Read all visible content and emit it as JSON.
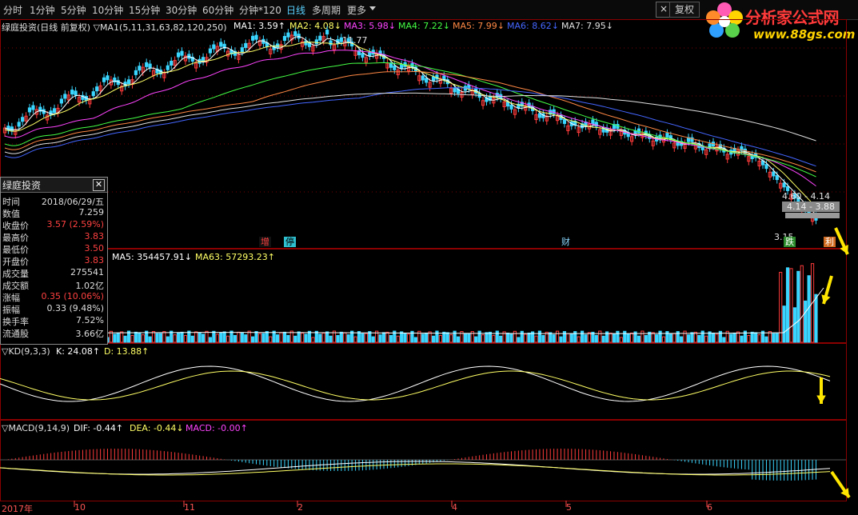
{
  "toolbar": {
    "periods": [
      "分时",
      "1分钟",
      "5分钟",
      "10分钟",
      "15分钟",
      "30分钟",
      "60分钟",
      "分钟*120",
      "日线",
      "多周期",
      "更多"
    ],
    "active": "日线",
    "right_btn": "复权",
    "close": "×"
  },
  "logo": {
    "name": "分析家公式网",
    "url": "www.88gs.com"
  },
  "main_header": {
    "title": "绿庭投资(日线 前复权) ▽MA1(5,11,31,63,82,120,250)",
    "ma": [
      {
        "label": "MA1: 3.59↑",
        "color": "#ffffff"
      },
      {
        "label": "MA2: 4.08↓",
        "color": "#ffff66"
      },
      {
        "label": "MA3: 5.98↓",
        "color": "#ff44ff"
      },
      {
        "label": "MA4: 7.22↓",
        "color": "#44ff44"
      },
      {
        "label": "MA5: 7.99↓",
        "color": "#ff8844"
      },
      {
        "label": "MA6: 8.62↓",
        "color": "#4466ff"
      },
      {
        "label": "MA7: 7.95↓",
        "color": "#e0e0e0"
      }
    ]
  },
  "price_notes": {
    "high": "11.77",
    "r1": "4.60 - 4.14",
    "r2": "4.14 - 3.88",
    "low": "3.15"
  },
  "markers": [
    {
      "text": "增",
      "kind": "red"
    },
    {
      "text": "停",
      "kind": "cyan"
    },
    {
      "text": "财",
      "kind": "cyan"
    },
    {
      "text": "跌",
      "kind": "green"
    },
    {
      "text": "利",
      "kind": "orange"
    }
  ],
  "vol_header": {
    "ma5": "MA5: 354457.91↓",
    "ma63": "MA63: 57293.23↑"
  },
  "kd_header": {
    "title": "▽KD(9,3,3)",
    "k": "K: 24.08↑",
    "d": "D: 13.88↑"
  },
  "macd_header": {
    "title": "▽MACD(9,14,9)",
    "dif": "DIF: -0.44↑",
    "dea": "DEA: -0.44↓",
    "macd": "MACD: -0.00↑"
  },
  "xaxis": [
    "2017年",
    "10",
    "11",
    "2",
    "4",
    "5",
    "6"
  ],
  "info": {
    "title": "绿庭投资",
    "rows": [
      {
        "l": "时间",
        "v": "2018/06/29/五",
        "red": false
      },
      {
        "l": "数值",
        "v": "7.259",
        "red": false
      },
      {
        "l": "收盘价",
        "v": "3.57 (2.59%)",
        "red": true
      },
      {
        "l": "最高价",
        "v": "3.83",
        "red": true
      },
      {
        "l": "最低价",
        "v": "3.50",
        "red": true
      },
      {
        "l": "开盘价",
        "v": "3.83",
        "red": true
      },
      {
        "l": "成交量",
        "v": "275541",
        "red": false
      },
      {
        "l": "成交额",
        "v": "1.02亿",
        "red": false
      },
      {
        "l": "涨幅",
        "v": "0.35 (10.06%)",
        "red": true
      },
      {
        "l": "振幅",
        "v": "0.33 (9.48%)",
        "red": false
      },
      {
        "l": "换手率",
        "v": "7.52%",
        "red": false
      },
      {
        "l": "流通股",
        "v": "3.66亿",
        "red": false
      }
    ]
  }
}
